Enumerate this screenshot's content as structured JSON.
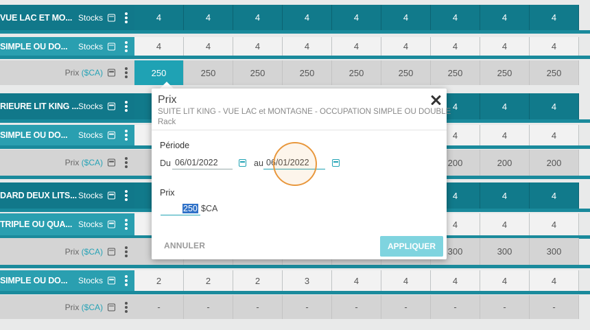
{
  "rows": [
    {
      "kind": "dark",
      "name": "VUE LAC ET MO...",
      "type": "Stocks",
      "unit": "",
      "values": [
        "4",
        "4",
        "4",
        "4",
        "4",
        "4",
        "4",
        "4",
        "4"
      ]
    },
    {
      "kind": "teal",
      "name": "SIMPLE OU DO...",
      "type": "Stocks",
      "unit": "",
      "values": [
        "4",
        "4",
        "4",
        "4",
        "4",
        "4",
        "4",
        "4",
        "4"
      ]
    },
    {
      "kind": "price",
      "name": "",
      "type": "Prix ",
      "unit": "($CA)",
      "values": [
        "250",
        "250",
        "250",
        "250",
        "250",
        "250",
        "250",
        "250",
        "250"
      ]
    },
    {
      "kind": "dark",
      "name": "RIEURE LIT KING ...",
      "type": "Stocks",
      "unit": "",
      "values": [
        "",
        "",
        "",
        "",
        "",
        "",
        "4",
        "4",
        "4"
      ]
    },
    {
      "kind": "teal",
      "name": "SIMPLE OU DO...",
      "type": "Stocks",
      "unit": "",
      "values": [
        "",
        "",
        "",
        "",
        "",
        "",
        "4",
        "4",
        "4"
      ]
    },
    {
      "kind": "price",
      "name": "",
      "type": "Prix ",
      "unit": "($CA)",
      "values": [
        "",
        "",
        "",
        "",
        "",
        "",
        "200",
        "200",
        "200"
      ]
    },
    {
      "kind": "dark",
      "name": "DARD DEUX LITS...",
      "type": "Stocks",
      "unit": "",
      "values": [
        "",
        "",
        "",
        "",
        "",
        "",
        "4",
        "4",
        "4"
      ]
    },
    {
      "kind": "teal",
      "name": "TRIPLE OU QUA...",
      "type": "Stocks",
      "unit": "",
      "values": [
        "",
        "",
        "",
        "",
        "",
        "",
        "4",
        "4",
        "4"
      ]
    },
    {
      "kind": "price",
      "name": "",
      "type": "Prix ",
      "unit": "($CA)",
      "values": [
        "",
        "",
        "",
        "",
        "",
        "",
        "300",
        "300",
        "300"
      ]
    },
    {
      "kind": "teal",
      "name": "SIMPLE OU DO...",
      "type": "Stocks",
      "unit": "",
      "values": [
        "2",
        "2",
        "2",
        "3",
        "4",
        "4",
        "4",
        "4",
        "4"
      ]
    },
    {
      "kind": "price",
      "name": "",
      "type": "Prix ",
      "unit": "($CA)",
      "values": [
        "-",
        "-",
        "-",
        "-",
        "-",
        "-",
        "-",
        "-",
        "-"
      ]
    }
  ],
  "popup": {
    "title": "Prix",
    "subtitle": "SUITE LIT KING - VUE LAC et MONTAGNE - OCCUPATION SIMPLE OU DOUBLE",
    "rate": "Rack",
    "period_label": "Période",
    "from_label": "Du",
    "from_value": "06/01/2022",
    "to_label": "au",
    "to_value": "06/01/2022",
    "price_label": "Prix",
    "price_value": "250",
    "currency": "$CA",
    "cancel_label": "ANNULER",
    "apply_label": "APPLIQUER"
  },
  "colors": {
    "dark_teal": "#117a8b",
    "teal": "#2a9fb0",
    "highlight": "#1fa2b4",
    "apply": "#7fd4df"
  }
}
